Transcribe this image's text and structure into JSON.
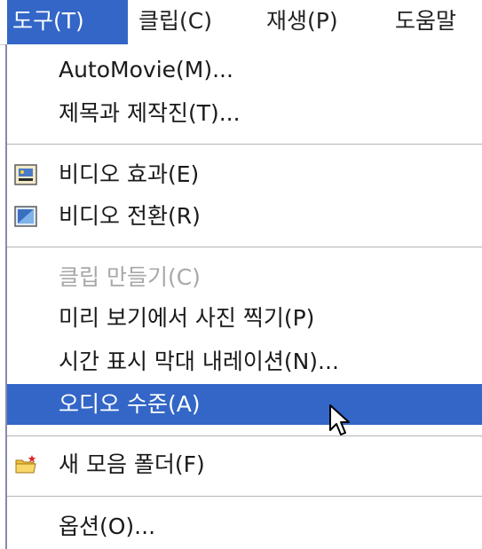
{
  "menubar": {
    "items": [
      "도구(T)",
      "클립(C)",
      "재생(P)",
      "도움말"
    ]
  },
  "menu": {
    "items": [
      {
        "label": "AutoMovie(M)..."
      },
      {
        "label": "제목과 제작진(T)..."
      },
      {
        "label": "비디오 효과(E)",
        "icon": "video-effects-icon"
      },
      {
        "label": "비디오 전환(R)",
        "icon": "video-transitions-icon"
      },
      {
        "label": "클립 만들기(C)",
        "disabled": true
      },
      {
        "label": "미리 보기에서 사진 찍기(P)"
      },
      {
        "label": "시간 표시 막대 내레이션(N)..."
      },
      {
        "label": "오디오 수준(A)",
        "highlighted": true
      },
      {
        "label": "새 모음 폴더(F)",
        "icon": "new-folder-icon"
      },
      {
        "label": "옵션(O)..."
      }
    ]
  },
  "colors": {
    "highlight": "#3366c7",
    "disabled_text": "#a8a8a8"
  }
}
